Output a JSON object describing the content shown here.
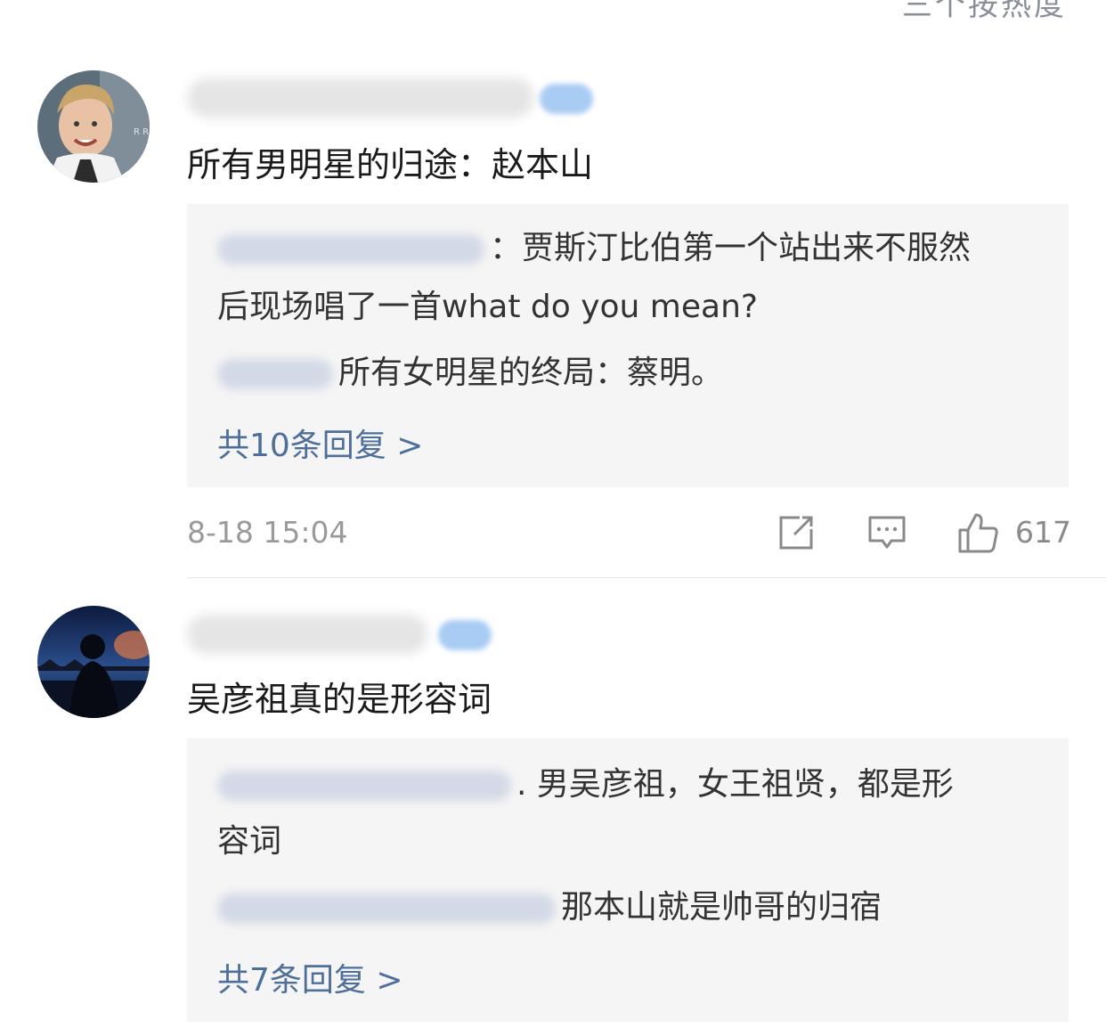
{
  "header": {
    "sort_label": "三个按热度"
  },
  "comments": [
    {
      "text": "所有男明星的归途：赵本山",
      "replies": [
        {
          "text": "：贾斯汀比伯第一个站出来不服然",
          "text_cont": "后现场唱了一首what do you mean?"
        },
        {
          "text": "所有女明星的终局：蔡明。"
        }
      ],
      "reply_count": "共10条回复 >",
      "time": "8-18 15:04",
      "likes": "617",
      "icons": [
        "repost-icon",
        "comment-icon",
        "like-icon"
      ]
    },
    {
      "text": "吴彦祖真的是形容词",
      "replies": [
        {
          "text": ". 男吴彦祖，女王祖贤，都是形",
          "text_cont": "容词"
        },
        {
          "text": "那本山就是帅哥的归宿"
        }
      ],
      "reply_count": "共7条回复 >"
    }
  ],
  "colors": {
    "link": "#4e6f9a",
    "reply_bg": "#f5f5f5",
    "meta": "#9a9a9a"
  }
}
